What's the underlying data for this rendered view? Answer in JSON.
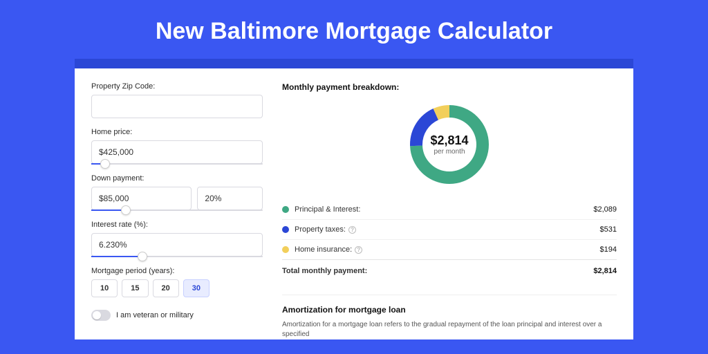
{
  "hero": {
    "title": "New Baltimore Mortgage Calculator"
  },
  "form": {
    "zip": {
      "label": "Property Zip Code:",
      "value": ""
    },
    "price": {
      "label": "Home price:",
      "value": "$425,000",
      "slider_pct": 8
    },
    "down": {
      "label": "Down payment:",
      "amount": "$85,000",
      "percent": "20%",
      "slider_pct": 20
    },
    "rate": {
      "label": "Interest rate (%):",
      "value": "6.230%",
      "slider_pct": 30
    },
    "period": {
      "label": "Mortgage period (years):",
      "options": [
        "10",
        "15",
        "20",
        "30"
      ],
      "selected": "30"
    },
    "veteran": {
      "label": "I am veteran or military"
    }
  },
  "breakdown": {
    "title": "Monthly payment breakdown:",
    "center_amount": "$2,814",
    "center_sub": "per month",
    "rows": [
      {
        "color": "#3fa884",
        "label": "Principal & Interest:",
        "info": false,
        "value": "$2,089"
      },
      {
        "color": "#2b47d6",
        "label": "Property taxes:",
        "info": true,
        "value": "$531"
      },
      {
        "color": "#f2cf5b",
        "label": "Home insurance:",
        "info": true,
        "value": "$194"
      }
    ],
    "total": {
      "label": "Total monthly payment:",
      "value": "$2,814"
    }
  },
  "amort": {
    "title": "Amortization for mortgage loan",
    "body": "Amortization for a mortgage loan refers to the gradual repayment of the loan principal and interest over a specified"
  },
  "chart_data": {
    "type": "pie",
    "title": "Monthly payment breakdown",
    "series": [
      {
        "name": "Principal & Interest",
        "value": 2089,
        "color": "#3fa884"
      },
      {
        "name": "Property taxes",
        "value": 531,
        "color": "#2b47d6"
      },
      {
        "name": "Home insurance",
        "value": 194,
        "color": "#f2cf5b"
      }
    ],
    "total": 2814,
    "center_label": "$2,814 per month"
  }
}
